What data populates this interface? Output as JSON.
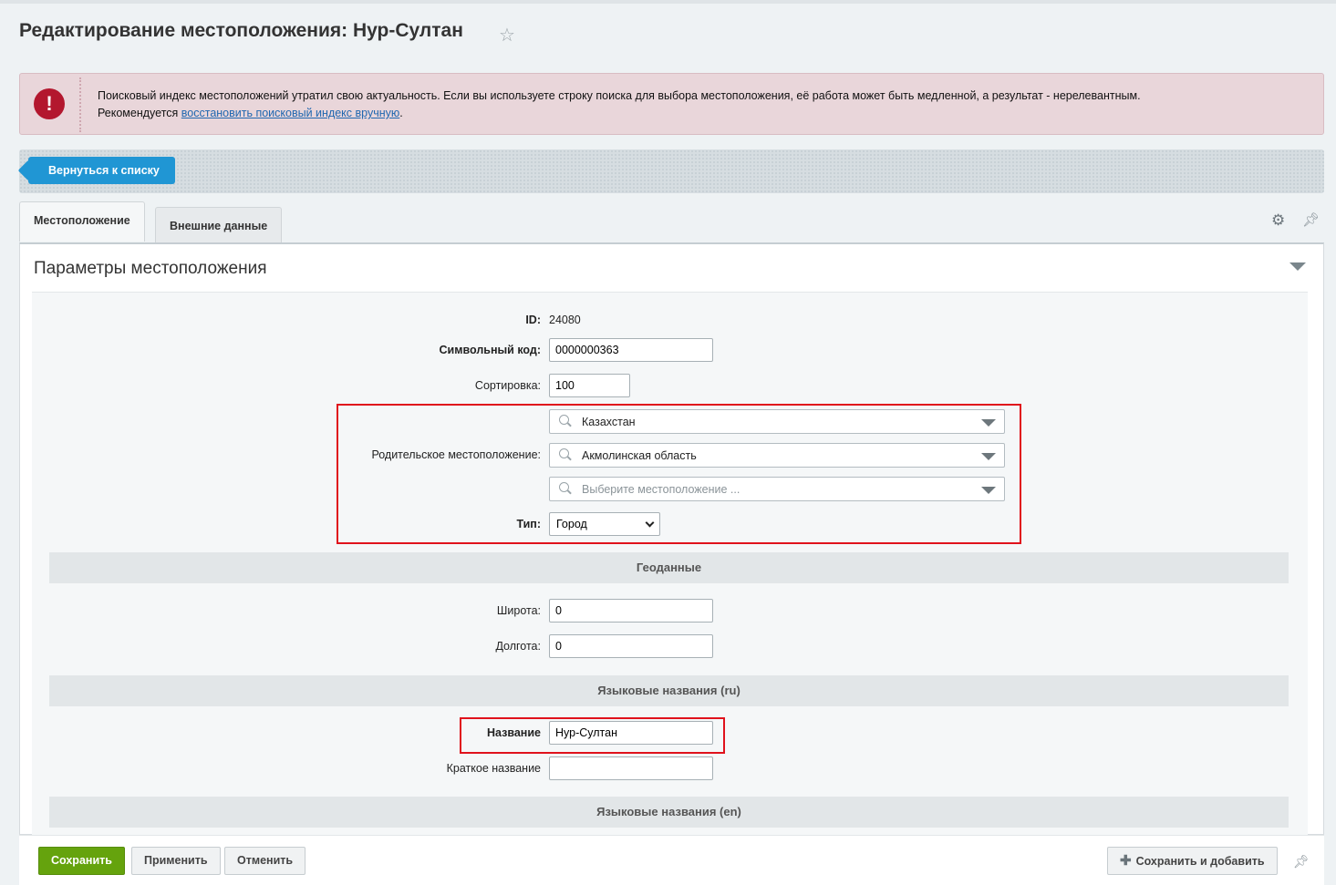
{
  "page": {
    "title": "Редактирование местоположения: Нур-Султан"
  },
  "alert": {
    "text_line1": "Поисковый индекс местоположений утратил свою актуальность. Если вы используете строку поиска для выбора местоположения, её работа может быть медленной, а результат - нерелевантным.",
    "text_prefix": "Рекомендуется ",
    "link": "восстановить поисковый индекс вручную",
    "text_suffix": ".",
    "icon": "!"
  },
  "toolbar": {
    "back_label": "Вернуться к списку"
  },
  "tabs": [
    {
      "label": "Местоположение",
      "active": true
    },
    {
      "label": "Внешние данные",
      "active": false
    }
  ],
  "panel": {
    "title": "Параметры местоположения"
  },
  "form": {
    "id_label": "ID:",
    "id_value": "24080",
    "code_label": "Символьный код:",
    "code_value": "0000000363",
    "sort_label": "Сортировка:",
    "sort_value": "100",
    "parent_label": "Родительское местоположение:",
    "parent_levels": [
      "Казахстан",
      "Акмолинская область"
    ],
    "parent_placeholder": "Выберите местоположение ...",
    "type_label": "Тип:",
    "type_value": "Город",
    "geo_section": "Геоданные",
    "lat_label": "Широта:",
    "lat_value": "0",
    "lon_label": "Долгота:",
    "lon_value": "0",
    "ru_section": "Языковые названия (ru)",
    "name_label": "Название",
    "name_value": "Нур-Султан",
    "short_label": "Краткое название",
    "short_value": "",
    "en_section": "Языковые названия (en)"
  },
  "footer": {
    "save": "Сохранить",
    "apply": "Применить",
    "cancel": "Отменить",
    "save_add": "Сохранить и добавить"
  },
  "colors": {
    "accent_blue": "#2096d4",
    "save_green": "#65a30d",
    "alert_red": "#b3172e",
    "highlight_red": "#e0121c"
  }
}
